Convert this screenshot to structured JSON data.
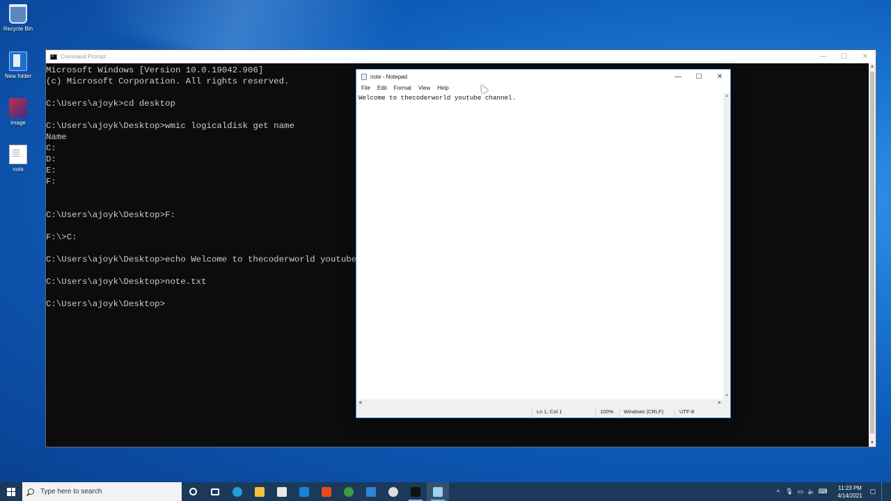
{
  "desktop": {
    "icons": [
      {
        "label": "Recycle Bin",
        "icon": "recycle-bin-icon"
      },
      {
        "label": "New folder",
        "icon": "folder-icon"
      },
      {
        "label": "image",
        "icon": "image-file-icon"
      },
      {
        "label": "note",
        "icon": "text-file-icon"
      }
    ]
  },
  "cmd": {
    "title": "Command Prompt",
    "lines": [
      "Microsoft Windows [Version 10.0.19042.906]",
      "(c) Microsoft Corporation. All rights reserved.",
      "",
      "C:\\Users\\ajoyk>cd desktop",
      "",
      "C:\\Users\\ajoyk\\Desktop>wmic logicaldisk get name",
      "Name",
      "C:",
      "D:",
      "E:",
      "F:",
      "",
      "",
      "C:\\Users\\ajoyk\\Desktop>F:",
      "",
      "F:\\>C:",
      "",
      "C:\\Users\\ajoyk\\Desktop>echo Welcome to thecoderworld youtube",
      "",
      "C:\\Users\\ajoyk\\Desktop>note.txt",
      "",
      "C:\\Users\\ajoyk\\Desktop>"
    ]
  },
  "notepad": {
    "title": "note - Notepad",
    "menu": [
      "File",
      "Edit",
      "Format",
      "View",
      "Help"
    ],
    "content": "Welcome to thecoderworld youtube channel.",
    "status": {
      "position": "Ln 1, Col 1",
      "zoom": "100%",
      "line_ending": "Windows (CRLF)",
      "encoding": "UTF-8"
    }
  },
  "taskbar": {
    "search_placeholder": "Type here to search",
    "apps": [
      {
        "name": "cortana-icon",
        "color": "#ffffff"
      },
      {
        "name": "task-view-icon",
        "color": "#ffffff"
      },
      {
        "name": "edge-icon",
        "color": "#2a9bd8"
      },
      {
        "name": "file-explorer-icon",
        "color": "#f3c33c"
      },
      {
        "name": "store-icon",
        "color": "#e8e8e8"
      },
      {
        "name": "mail-icon",
        "color": "#1a82d6"
      },
      {
        "name": "office-icon",
        "color": "#e84a1f"
      },
      {
        "name": "chrome-icon",
        "color": "#3c9d3c"
      },
      {
        "name": "whiteboard-icon",
        "color": "#2f84d9"
      },
      {
        "name": "obs-icon",
        "color": "#dcdcdc"
      },
      {
        "name": "cmd-icon",
        "color": "#111111"
      },
      {
        "name": "notepad-icon",
        "color": "#9ed0f0"
      }
    ],
    "clock": {
      "time": "11:23 PM",
      "date": "4/14/2021"
    }
  }
}
